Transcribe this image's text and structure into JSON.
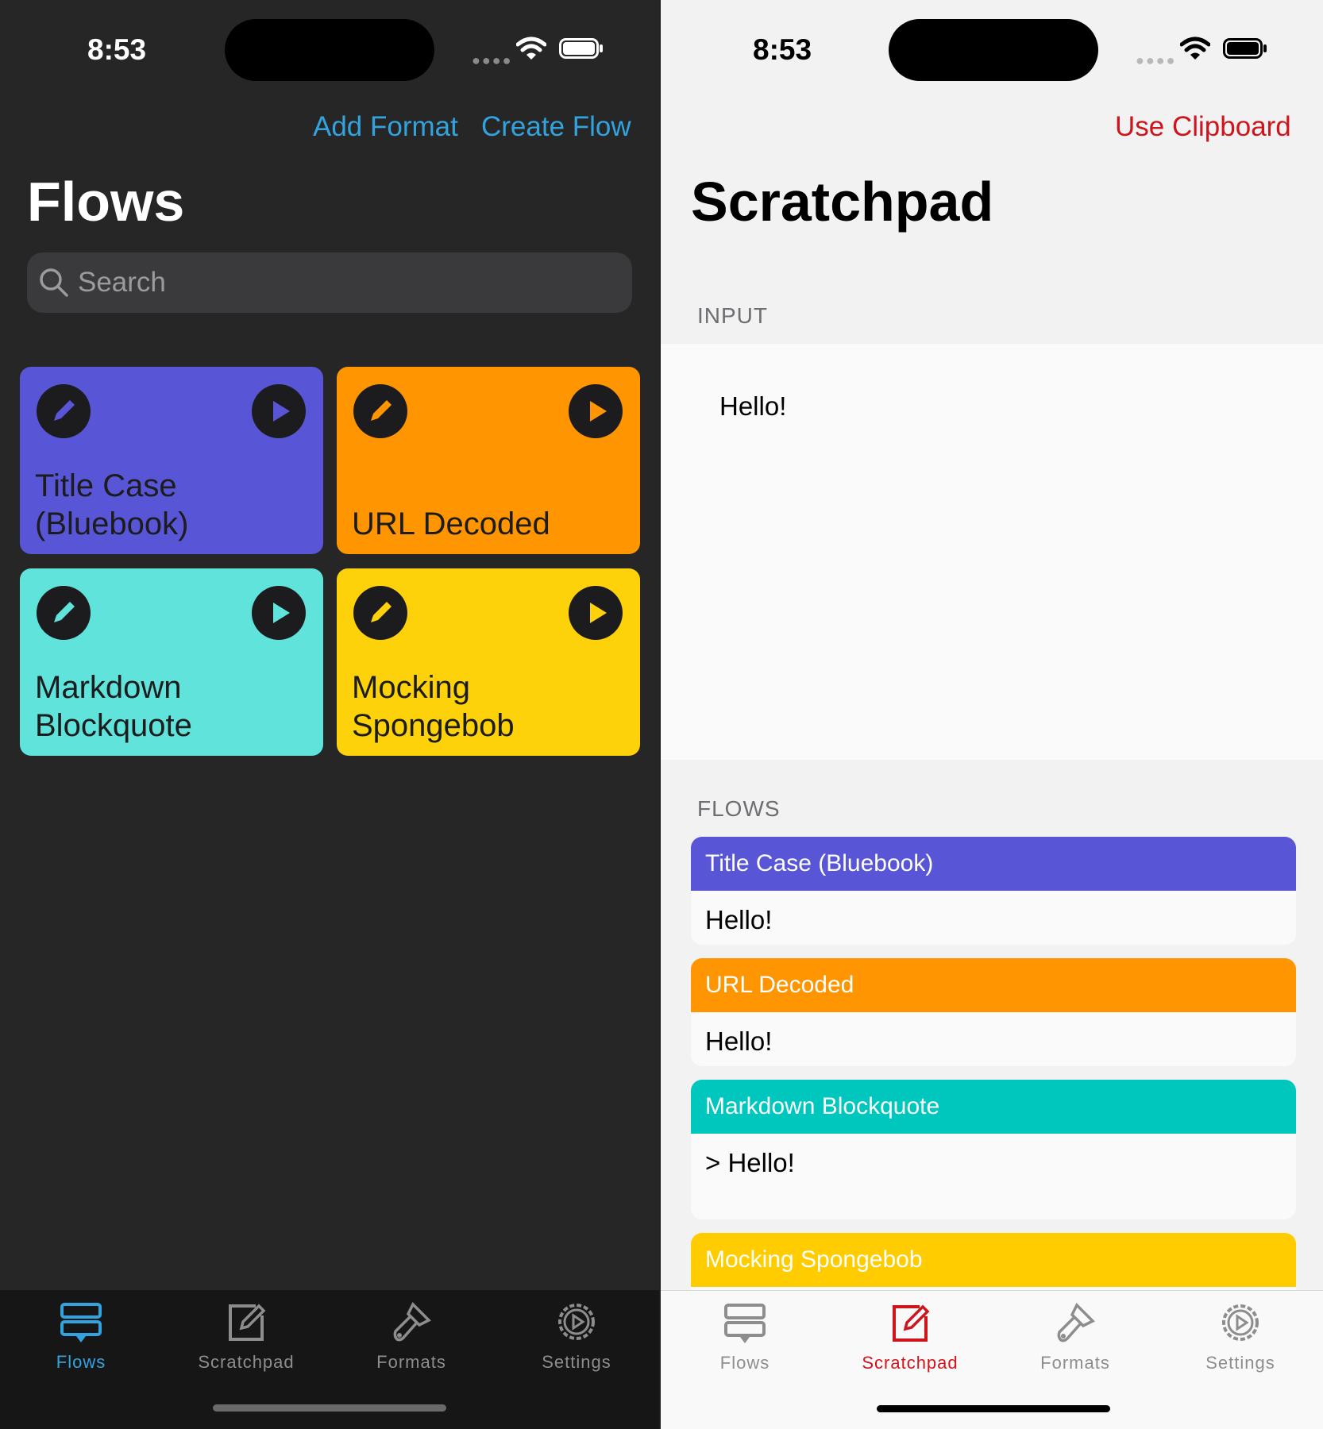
{
  "left": {
    "status": {
      "time": "8:53"
    },
    "nav": {
      "add_format": "Add Format",
      "create_flow": "Create Flow"
    },
    "title": "Flows",
    "search": {
      "placeholder": "Search"
    },
    "flows": [
      {
        "name": "Title Case (Bluebook)",
        "line1": "Title Case",
        "line2": "(Bluebook)",
        "color": "#5856d6",
        "icon_color": "#5856d6"
      },
      {
        "name": "URL Decoded",
        "line1": "URL Decoded",
        "line2": "",
        "color": "#ff9500",
        "icon_color": "#ff9500"
      },
      {
        "name": "Markdown Blockquote",
        "line1": "Markdown",
        "line2": "Blockquote",
        "color": "#5fe3da",
        "icon_color": "#5fe3da"
      },
      {
        "name": "Mocking Spongebob",
        "line1": "Mocking",
        "line2": "Spongebob",
        "color": "#fdd20a",
        "icon_color": "#fdd20a"
      }
    ],
    "tabs": [
      {
        "label": "Flows",
        "icon": "flows-icon",
        "active": true
      },
      {
        "label": "Scratchpad",
        "icon": "scratchpad-icon",
        "active": false
      },
      {
        "label": "Formats",
        "icon": "formats-icon",
        "active": false
      },
      {
        "label": "Settings",
        "icon": "settings-icon",
        "active": false
      }
    ],
    "accent": "#32a3de"
  },
  "right": {
    "status": {
      "time": "8:53"
    },
    "nav": {
      "use_clipboard": "Use Clipboard"
    },
    "title": "Scratchpad",
    "input_section": {
      "label": "INPUT",
      "text": "Hello!"
    },
    "flows_section": {
      "label": "FLOWS",
      "results": [
        {
          "name": "Title Case (Bluebook)",
          "output": "Hello!",
          "color": "#5856d6"
        },
        {
          "name": "URL Decoded",
          "output": "Hello!",
          "color": "#ff9500"
        },
        {
          "name": "Markdown Blockquote",
          "output": "> Hello!",
          "color": "#00c7be"
        },
        {
          "name": "Mocking Spongebob",
          "output": "",
          "color": "#ffcc00"
        }
      ]
    },
    "tabs": [
      {
        "label": "Flows",
        "icon": "flows-icon",
        "active": false
      },
      {
        "label": "Scratchpad",
        "icon": "scratchpad-icon",
        "active": true
      },
      {
        "label": "Formats",
        "icon": "formats-icon",
        "active": false
      },
      {
        "label": "Settings",
        "icon": "settings-icon",
        "active": false
      }
    ],
    "accent": "#d0141c"
  }
}
